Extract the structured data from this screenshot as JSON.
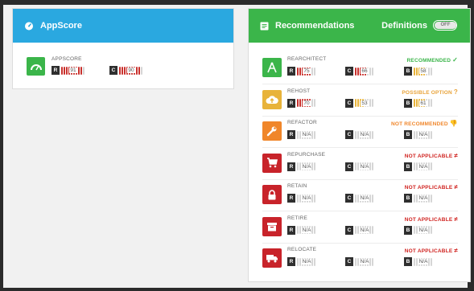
{
  "appscore_panel": {
    "title": "AppScore",
    "row": {
      "name": "APPSCORE",
      "scores": [
        {
          "label": "R",
          "value": "91",
          "level": 0.91,
          "color": "#c9302c"
        },
        {
          "label": "C",
          "value": "90",
          "level": 0.9,
          "color": "#c9302c"
        }
      ]
    }
  },
  "recommendations_panel": {
    "title": "Recommendations",
    "definitions_label": "Definitions",
    "toggle_text": "OFF",
    "rows": [
      {
        "name": "REARCHITECT",
        "status": "RECOMMENDED",
        "status_symbol": "✓",
        "status_color": "#3bb54a",
        "icon": "rearchitect-icon",
        "icon_bg": "#3bb54a",
        "scores": [
          {
            "label": "R",
            "value": "75",
            "level": 0.75,
            "color": "#c9302c"
          },
          {
            "label": "C",
            "value": "66",
            "level": 0.66,
            "color": "#c9302c"
          },
          {
            "label": "B",
            "value": "58",
            "level": 0.58,
            "color": "#e8b33a"
          }
        ]
      },
      {
        "name": "REHOST",
        "status": "POSSIBLE OPTION",
        "status_symbol": "?",
        "status_color": "#e8a33a",
        "icon": "cloud-upload-icon",
        "icon_bg": "#e8b33a",
        "scores": [
          {
            "label": "R",
            "value": "70",
            "level": 0.7,
            "color": "#c9302c"
          },
          {
            "label": "C",
            "value": "53",
            "level": 0.53,
            "color": "#e8b33a"
          },
          {
            "label": "B",
            "value": "61",
            "level": 0.61,
            "color": "#e8b33a"
          }
        ]
      },
      {
        "name": "REFACTOR",
        "status": "NOT RECOMMENDED",
        "status_symbol": "👎",
        "status_color": "#f0862a",
        "icon": "wrench-icon",
        "icon_bg": "#f0862a",
        "scores": [
          {
            "label": "R",
            "value": "N/A",
            "level": 0,
            "color": "#d6d6d6"
          },
          {
            "label": "C",
            "value": "N/A",
            "level": 0,
            "color": "#d6d6d6"
          },
          {
            "label": "B",
            "value": "N/A",
            "level": 0,
            "color": "#d6d6d6"
          }
        ]
      },
      {
        "name": "REPURCHASE",
        "status": "NOT APPLICABLE",
        "status_symbol": "≠",
        "status_color": "#d0221f",
        "icon": "cart-icon",
        "icon_bg": "#c8232a",
        "scores": [
          {
            "label": "R",
            "value": "N/A",
            "level": 0,
            "color": "#d6d6d6"
          },
          {
            "label": "C",
            "value": "N/A",
            "level": 0,
            "color": "#d6d6d6"
          },
          {
            "label": "B",
            "value": "N/A",
            "level": 0,
            "color": "#d6d6d6"
          }
        ]
      },
      {
        "name": "RETAIN",
        "status": "NOT APPLICABLE",
        "status_symbol": "≠",
        "status_color": "#d0221f",
        "icon": "lock-icon",
        "icon_bg": "#c8232a",
        "scores": [
          {
            "label": "R",
            "value": "N/A",
            "level": 0,
            "color": "#d6d6d6"
          },
          {
            "label": "C",
            "value": "N/A",
            "level": 0,
            "color": "#d6d6d6"
          },
          {
            "label": "B",
            "value": "N/A",
            "level": 0,
            "color": "#d6d6d6"
          }
        ]
      },
      {
        "name": "RETIRE",
        "status": "NOT APPLICABLE",
        "status_symbol": "≠",
        "status_color": "#d0221f",
        "icon": "archive-icon",
        "icon_bg": "#c8232a",
        "scores": [
          {
            "label": "R",
            "value": "N/A",
            "level": 0,
            "color": "#d6d6d6"
          },
          {
            "label": "C",
            "value": "N/A",
            "level": 0,
            "color": "#d6d6d6"
          },
          {
            "label": "B",
            "value": "N/A",
            "level": 0,
            "color": "#d6d6d6"
          }
        ]
      },
      {
        "name": "RELOCATE",
        "status": "NOT APPLICABLE",
        "status_symbol": "≠",
        "status_color": "#d0221f",
        "icon": "truck-icon",
        "icon_bg": "#c8232a",
        "scores": [
          {
            "label": "R",
            "value": "N/A",
            "level": 0,
            "color": "#d6d6d6"
          },
          {
            "label": "C",
            "value": "N/A",
            "level": 0,
            "color": "#d6d6d6"
          },
          {
            "label": "B",
            "value": "N/A",
            "level": 0,
            "color": "#d6d6d6"
          }
        ]
      }
    ]
  }
}
